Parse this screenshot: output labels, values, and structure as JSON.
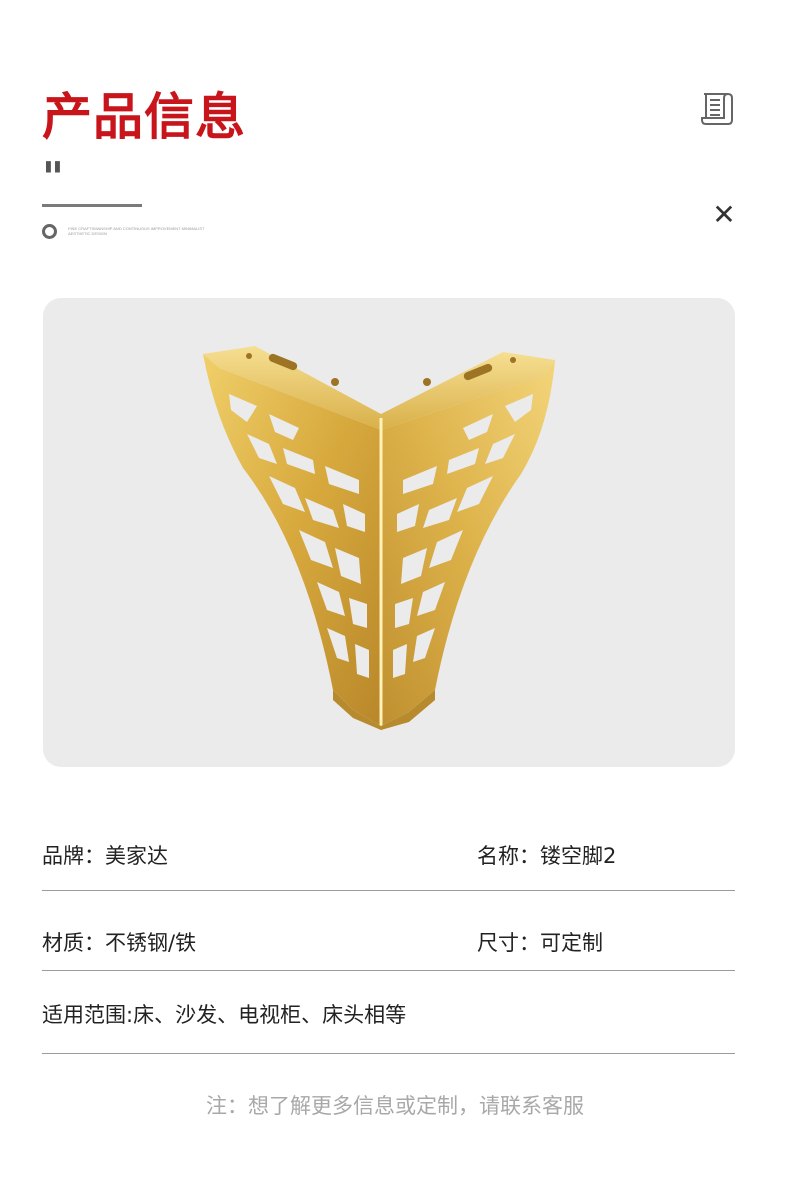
{
  "header": {
    "title": "产品信息",
    "quote_mark": "\"",
    "tagline": "fine craftsmanship and continuous improvement minimalist aesthetic design"
  },
  "icons": {
    "scroll": "scroll-document-icon",
    "close": "close-icon",
    "close_glyph": "✕"
  },
  "photo": {
    "subject": "gold-furniture-leg-image"
  },
  "specs": {
    "brand": "品牌：美家达",
    "name": "名称：镂空脚2",
    "material": "材质：不锈钢/铁",
    "size": "尺寸：可定制",
    "usage": "适用范围:床、沙发、电视柜、床头相等"
  },
  "note": "注：想了解更多信息或定制，请联系客服",
  "colors": {
    "accent": "#c8151b",
    "gold": "#d9b24a",
    "panel": "#ebebeb"
  }
}
